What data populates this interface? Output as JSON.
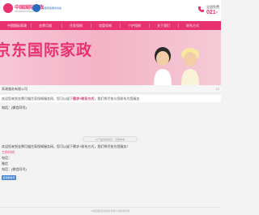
{
  "header": {
    "logo_title": "中国国际家政",
    "logo_sub": "INTERNATIONAL",
    "partner_text": "中国家政服务协会",
    "phone_label": "全国免费",
    "phone_number": "021-"
  },
  "nav": {
    "items": [
      {
        "label": "中国国际家政"
      },
      {
        "label": "金牌月嫂"
      },
      {
        "label": "住家保姆"
      },
      {
        "label": "育婴保姆"
      },
      {
        "label": "个护保姆"
      },
      {
        "label": "关于我们"
      },
      {
        "label": "联系方式"
      }
    ]
  },
  "banner": {
    "title": "京东国际家政"
  },
  "company_bar": {
    "name": "家政服务有限公司",
    "tag": "12"
  },
  "notice": {
    "prefix": "欢迎您来到金牌月嫂住家保姆服务网，您可以留下",
    "highlight": "需求+联系方式",
    "suffix": "，我们将尽快与您联系为您服务"
  },
  "contact": {
    "label": "电话：(微信同号)"
  },
  "system_divider": {
    "text": "以下是系统消息，仅供参考"
  },
  "message": {
    "lines": [
      "欢迎您来到金牌月嫂住家保姆服务网，您可以留下需求+联系方式，我们将尽快为您服务！",
      "工作时间",
      "电话：",
      "微信",
      "电话：(微信同号)"
    ],
    "wechat_button": "复制微信号"
  },
  "footer": {
    "text": "中国国际家政服务有限公司版权所有"
  },
  "colors": {
    "brand_pink": "#e8316f",
    "partner_blue": "#2a6fbf",
    "button_blue": "#4c8ad3"
  }
}
